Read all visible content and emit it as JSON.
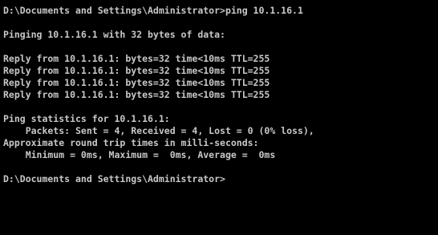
{
  "console": {
    "prompt_command": "D:\\Documents and Settings\\Administrator>ping 10.1.16.1",
    "pinging_line": "Pinging 10.1.16.1 with 32 bytes of data:",
    "replies": [
      "Reply from 10.1.16.1: bytes=32 time<10ms TTL=255",
      "Reply from 10.1.16.1: bytes=32 time<10ms TTL=255",
      "Reply from 10.1.16.1: bytes=32 time<10ms TTL=255",
      "Reply from 10.1.16.1: bytes=32 time<10ms TTL=255"
    ],
    "stats_header": "Ping statistics for 10.1.16.1:",
    "packets_line": "    Packets: Sent = 4, Received = 4, Lost = 0 (0% loss),",
    "approx_line": "Approximate round trip times in milli-seconds:",
    "times_line": "    Minimum = 0ms, Maximum =  0ms, Average =  0ms",
    "final_prompt": "D:\\Documents and Settings\\Administrator>"
  },
  "colors": {
    "background": "#000000",
    "text": "#c8c8c8"
  }
}
